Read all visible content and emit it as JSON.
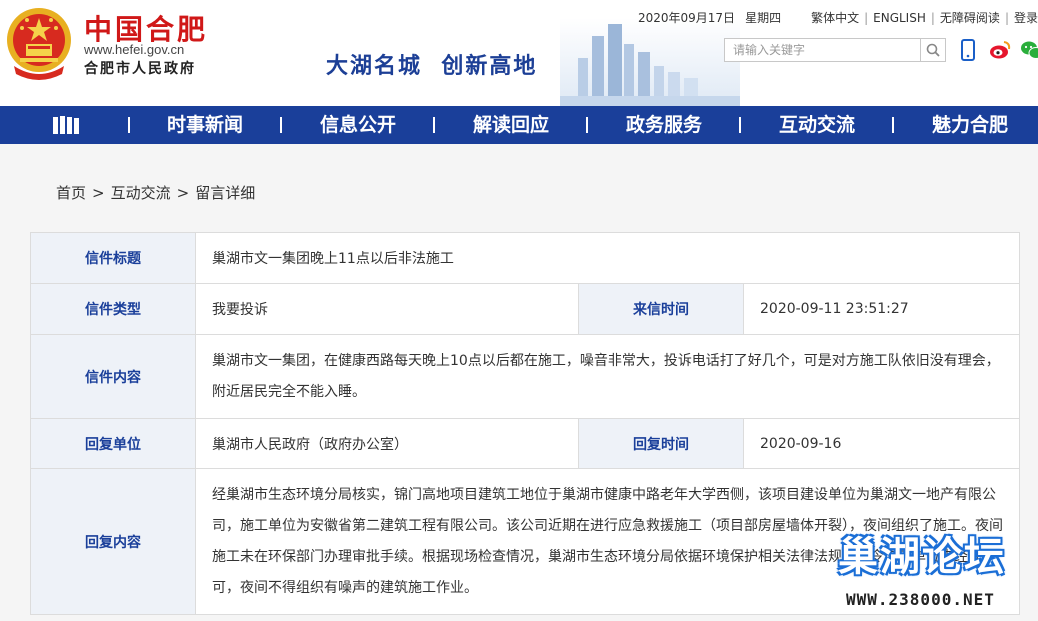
{
  "header": {
    "site_name": "中国合肥",
    "site_url": "www.hefei.gov.cn",
    "site_sub": "合肥市人民政府",
    "slogan": "大湖名城  创新高地",
    "date": "2020年09月17日",
    "weekday": "星期四",
    "links": [
      "繁体中文",
      "ENGLISH",
      "无障碍阅读",
      "登录"
    ],
    "search_placeholder": "请输入关键字",
    "icons": [
      "mobile-icon",
      "weibo-icon",
      "wechat-icon"
    ],
    "brand_red": "#d01818",
    "brand_blue": "#1a3f9a"
  },
  "nav": {
    "items": [
      "时事新闻",
      "信息公开",
      "解读回应",
      "政务服务",
      "互动交流",
      "魅力合肥"
    ]
  },
  "breadcrumb": [
    "首页",
    "互动交流",
    "留言详细"
  ],
  "letter": {
    "title_label": "信件标题",
    "title": "巢湖市文一集团晚上11点以后非法施工",
    "type_label": "信件类型",
    "type": "我要投诉",
    "time_label": "来信时间",
    "time": "2020-09-11 23:51:27",
    "content_label": "信件内容",
    "content": "巢湖市文一集团，在健康西路每天晚上10点以后都在施工，噪音非常大，投诉电话打了好几个，可是对方施工队依旧没有理会，附近居民完全不能入睡。",
    "reply_unit_label": "回复单位",
    "reply_unit": "巢湖市人民政府（政府办公室）",
    "reply_time_label": "回复时间",
    "reply_time": "2020-09-16",
    "reply_content_label": "回复内容",
    "reply_content": "经巢湖市生态环境分局核实，锦门高地项目建筑工地位于巢湖市健康中路老年大学西侧，该项目建设单位为巢湖文一地产有限公司，施工单位为安徽省第二建筑工程有限公司。该公司近期在进行应急救援施工（项目部房屋墙体开裂），夜间组织了施工。夜间施工未在环保部门办理审批手续。根据现场检查情况，巢湖市生态环境分局依据环境保护相关法律法规，责令施工单位未经许可，夜间不得组织有噪声的建筑施工作业。"
  },
  "watermark": {
    "title": "巢湖论坛",
    "url": "WWW.238000.NET"
  }
}
